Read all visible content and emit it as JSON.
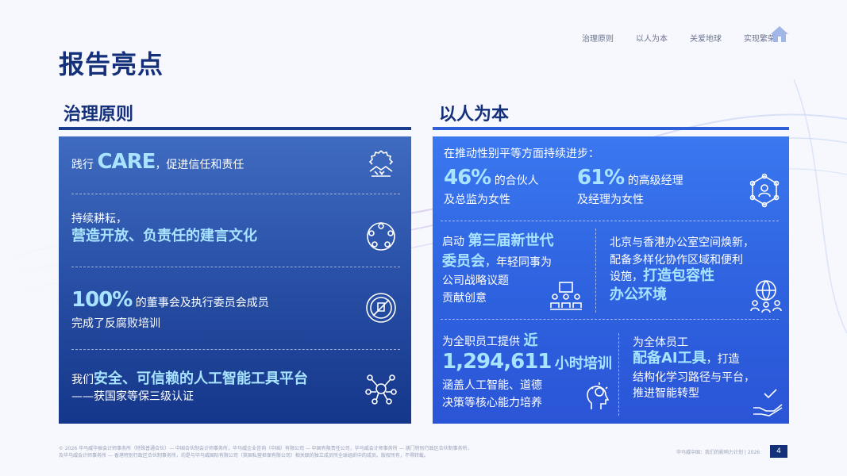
{
  "page": {
    "title": "报告亮点",
    "page_number": "4",
    "footer_left_1": "© 2026 毕马威华振会计师事务所（特殊普通合伙）— 中国合伙制会计师事务所，毕马威企业咨询（中国）有限公司 — 中国有限责任公司，毕马威会计师事务所 — 澳门特别行政区合伙制事务所，",
    "footer_left_2": "及毕马威会计师事务所 — 香港特别行政区合伙制事务所，均是与毕马威国际有限公司（英国私营担保有限公司）相关联的独立成员所全球组织中的成员。版权所有，不得转载。",
    "footer_right": "毕马威中国：我们的影响力计划 | 2026"
  },
  "nav": {
    "items": [
      "治理原则",
      "以人为本",
      "关爱地球",
      "实现繁荣"
    ]
  },
  "left": {
    "heading": "治理原则",
    "b1_pre": "践行",
    "b1_big": "CARE",
    "b1_post": "，促进信任和责任",
    "b2_line1": "持续耕耘，",
    "b2_line2": "营造开放、负责任的建言文化",
    "b3_big": "100%",
    "b3_post": "的董事会及执行委员会成员",
    "b3_line2": "完成了反腐败培训",
    "b4_pre": "我们",
    "b4_hl": "安全、可信赖的人工智能工具平台",
    "b4_line2": "——获国家等保三级认证"
  },
  "right": {
    "heading": "以人为本",
    "r1_intro": "在推动性别平等方面持续进步：",
    "r1_a_big": "46%",
    "r1_a_post": "的合伙人",
    "r1_a_line2": "及总监为女性",
    "r1_b_big": "61%",
    "r1_b_post": "的高级经理",
    "r1_b_line2": "及经理为女性",
    "r2_a_pre": "启动",
    "r2_a_hl1": "第三届新世代",
    "r2_a_hl2": "委员会",
    "r2_a_post": "，年轻同事为",
    "r2_a_line3": "公司战略议题",
    "r2_a_line4": "贡献创意",
    "r2_b_line1": "北京与香港办公室空间焕新，",
    "r2_b_line2": "配备多样化协作区域和便利",
    "r2_b_line3_pre": "设施，",
    "r2_b_line3_hl": "打造包容性",
    "r2_b_line4": "办公环境",
    "r3_a_pre": "为全职员工提供",
    "r3_a_hl": "近",
    "r3_a_big": "1,294,611",
    "r3_a_unit": "小时培训",
    "r3_a_line3": "涵盖人工智能、道德",
    "r3_a_line4": "决策等核心能力培养",
    "r3_b_line1": "为全体员工",
    "r3_b_hl": "配备AI工具",
    "r3_b_post": "，打造",
    "r3_b_line3": "结构化学习路径与平台，",
    "r3_b_line4": "推进智能转型"
  }
}
